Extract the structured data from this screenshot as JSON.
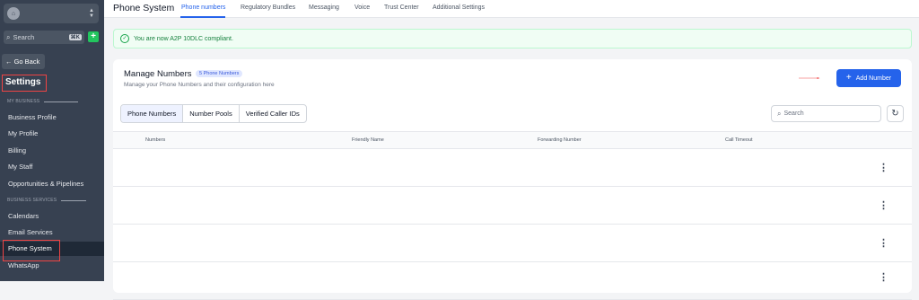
{
  "sidebar": {
    "search_placeholder": "Search",
    "search_shortcut": "⌘K",
    "add_label": "+",
    "go_back": "← Go Back",
    "settings_title": "Settings",
    "section_my_business": "MY BUSINESS",
    "section_business_services": "BUSINESS SERVICES",
    "items": [
      {
        "label": "Business Profile"
      },
      {
        "label": "My Profile"
      },
      {
        "label": "Billing"
      },
      {
        "label": "My Staff"
      },
      {
        "label": "Opportunities & Pipelines"
      },
      {
        "label": "Calendars"
      },
      {
        "label": "Email Services"
      },
      {
        "label": "Phone System",
        "active": true
      },
      {
        "label": "WhatsApp"
      }
    ]
  },
  "header": {
    "title": "Phone System",
    "tabs": [
      {
        "label": "Phone numbers",
        "active": true
      },
      {
        "label": "Regulatory Bundles"
      },
      {
        "label": "Messaging"
      },
      {
        "label": "Voice"
      },
      {
        "label": "Trust Center"
      },
      {
        "label": "Additional Settings"
      }
    ]
  },
  "banner": {
    "text": "You are now A2P 10DLC compliant."
  },
  "manage": {
    "title": "Manage Numbers",
    "count_badge": "5 Phone Numbers",
    "subtitle": "Manage your Phone Numbers and their configuration here",
    "add_button": "Add Number",
    "add_icon": "+",
    "segments": [
      "Phone Numbers",
      "Number Pools",
      "Verified Caller IDs"
    ],
    "search_placeholder": "Search",
    "columns": [
      "Numbers",
      "Friendly Name",
      "Forwarding Number",
      "Call Timeout"
    ]
  },
  "colors": {
    "accent": "#2563eb",
    "annotation": "#ef4444",
    "success": "#16a34a",
    "sidebar_bg": "#374151"
  }
}
